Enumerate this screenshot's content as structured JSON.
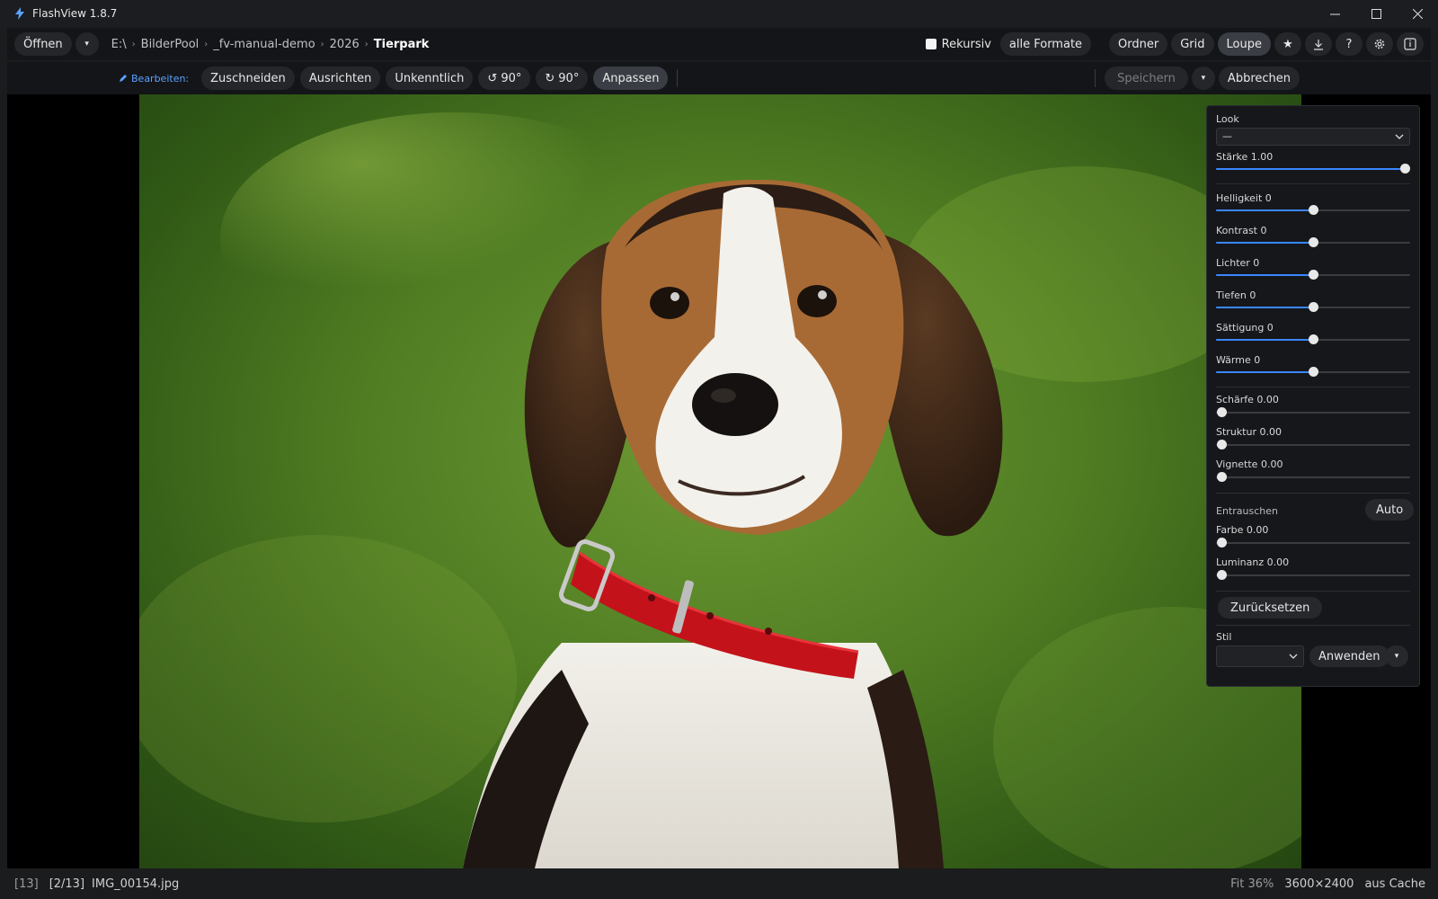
{
  "window": {
    "title": "FlashView 1.8.7"
  },
  "toolbar": {
    "open_label": "Öffnen",
    "open_dropdown": "▾",
    "breadcrumb": [
      "E:\\",
      "BilderPool",
      "_fv-manual-demo",
      "2026",
      "Tierpark"
    ],
    "recursive_label": "Rekursiv",
    "recursive_checked": false,
    "formats_label": "alle Formate",
    "views": [
      "Ordner",
      "Grid",
      "Loupe"
    ],
    "active_view": "Loupe",
    "star_icon": "★",
    "help_icon": "?"
  },
  "edit_bar": {
    "label": "Bearbeiten:",
    "crop_label": "Zuschneiden",
    "align_label": "Ausrichten",
    "blur_label": "Unkenntlich",
    "rotate_left_label": "90°",
    "rotate_right_label": "90°",
    "adjust_label": "Anpassen",
    "save_label": "Speichern",
    "save_dropdown": "▾",
    "cancel_label": "Abbrechen"
  },
  "adjust_panel": {
    "look_label": "Look",
    "look_value": "—",
    "sliders": [
      {
        "label": "Stärke 1.00",
        "value": 1.0
      },
      {
        "label": "Helligkeit 0",
        "value": 0.5
      },
      {
        "label": "Kontrast 0",
        "value": 0.5
      },
      {
        "label": "Lichter 0",
        "value": 0.5
      },
      {
        "label": "Tiefen 0",
        "value": 0.5
      },
      {
        "label": "Sättigung 0",
        "value": 0.5
      },
      {
        "label": "Wärme 0",
        "value": 0.5
      },
      {
        "label": "Schärfe 0.00",
        "value": 0.0
      },
      {
        "label": "Struktur 0.00",
        "value": 0.0
      },
      {
        "label": "Vignette 0.00",
        "value": 0.0
      }
    ],
    "denoise_label": "Entrauschen",
    "auto_label": "Auto",
    "denoise_sliders": [
      {
        "label": "Farbe 0.00",
        "value": 0.0
      },
      {
        "label": "Luminanz 0.00",
        "value": 0.0
      }
    ],
    "reset_label": "Zurücksetzen",
    "style_label": "Stil",
    "style_value": "",
    "apply_label": "Anwenden",
    "apply_dropdown": "▾"
  },
  "status": {
    "count": "[13]",
    "position": "[2/13]",
    "filename": "IMG_00154.jpg",
    "zoom": "Fit 36%",
    "dimensions": "3600×2400",
    "source": "aus Cache"
  },
  "colors": {
    "accent": "#3a86ff",
    "background": "#141518"
  }
}
